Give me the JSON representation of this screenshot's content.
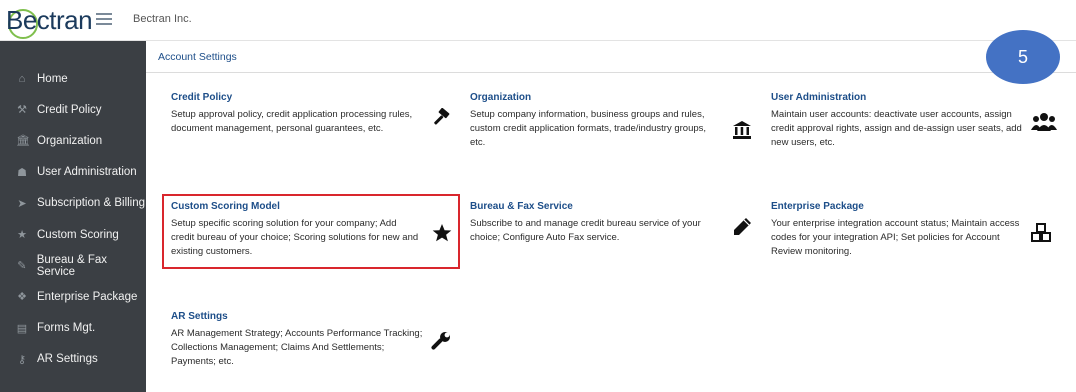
{
  "topbar": {
    "logo": "Bectran",
    "company": "Bectran Inc."
  },
  "sidebar": {
    "items": [
      {
        "label": "Home",
        "icon": "home-icon",
        "glyph": "⌂"
      },
      {
        "label": "Credit Policy",
        "icon": "gavel-icon",
        "glyph": "⚒"
      },
      {
        "label": "Organization",
        "icon": "bank-icon",
        "glyph": "🏛"
      },
      {
        "label": "User Administration",
        "icon": "users-icon",
        "glyph": "☗"
      },
      {
        "label": "Subscription & Billing",
        "icon": "send-icon",
        "glyph": "➤"
      },
      {
        "label": "Custom Scoring",
        "icon": "star-icon",
        "glyph": "★"
      },
      {
        "label": "Bureau & Fax Service",
        "icon": "pencil-icon",
        "glyph": "✎"
      },
      {
        "label": "Enterprise Package",
        "icon": "cubes-icon",
        "glyph": "❖"
      },
      {
        "label": "Forms Mgt.",
        "icon": "form-icon",
        "glyph": "▤"
      },
      {
        "label": "AR Settings",
        "icon": "wrench-icon",
        "glyph": "⚷"
      }
    ]
  },
  "breadcrumb": "Account Settings",
  "step_badge": "5",
  "cards": {
    "credit_policy": {
      "title": "Credit Policy",
      "desc": "Setup approval policy, credit application processing rules, document management, personal guarantees, etc.",
      "icon": "gavel-icon"
    },
    "organization": {
      "title": "Organization",
      "desc": "Setup company information, business groups and rules, custom credit application formats, trade/industry groups, etc.",
      "icon": "bank-icon"
    },
    "user_admin": {
      "title": "User Administration",
      "desc": "Maintain user accounts: deactivate user accounts, assign credit approval rights, assign and de-assign user seats, add new users, etc.",
      "icon": "users-icon"
    },
    "custom_scoring": {
      "title": "Custom Scoring Model",
      "desc": "Setup specific scoring solution for your company; Add credit bureau of your choice; Scoring solutions for new and existing customers.",
      "icon": "star-icon"
    },
    "bureau_fax": {
      "title": "Bureau & Fax Service",
      "desc": "Subscribe to and manage credit bureau service of your choice; Configure Auto Fax service.",
      "icon": "pencil-icon"
    },
    "enterprise": {
      "title": "Enterprise Package",
      "desc": "Your enterprise integration account status; Maintain access codes for your integration API; Set policies for Account Review monitoring.",
      "icon": "cubes-icon"
    },
    "ar_settings": {
      "title": "AR Settings",
      "desc": "AR Management Strategy; Accounts Performance Tracking; Collections Management; Claims And Settlements; Payments; etc.",
      "icon": "wrench-icon"
    }
  },
  "colors": {
    "sidebar_bg": "#3b3f44",
    "link_blue": "#1d4e89",
    "badge_blue": "#4472c4",
    "highlight_red": "#d9262d"
  }
}
